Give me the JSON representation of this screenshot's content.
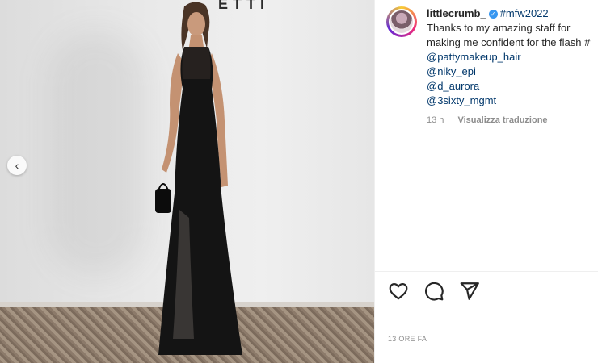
{
  "post": {
    "username": "littlecrumb_",
    "hashtag": "#mfw2022",
    "caption_lines": [
      "Thanks to my amazing staff for",
      "making me confident for the flash #"
    ],
    "mentions": [
      "@pattymakeup_hair",
      "@niky_epi",
      "@d_aurora",
      "@3sixty_mgmt"
    ],
    "age": "13 h",
    "translate_label": "Visualizza traduzione",
    "timestamp": "13 ORE FA",
    "banner_text": "ETTI"
  },
  "icons": {
    "prev": "chevron-left-icon",
    "like": "heart-icon",
    "comment": "comment-icon",
    "share": "paper-plane-icon",
    "verified": "verified-badge-icon"
  },
  "colors": {
    "link": "#00376b",
    "muted": "#8e8e8e",
    "verified": "#3897f0"
  }
}
